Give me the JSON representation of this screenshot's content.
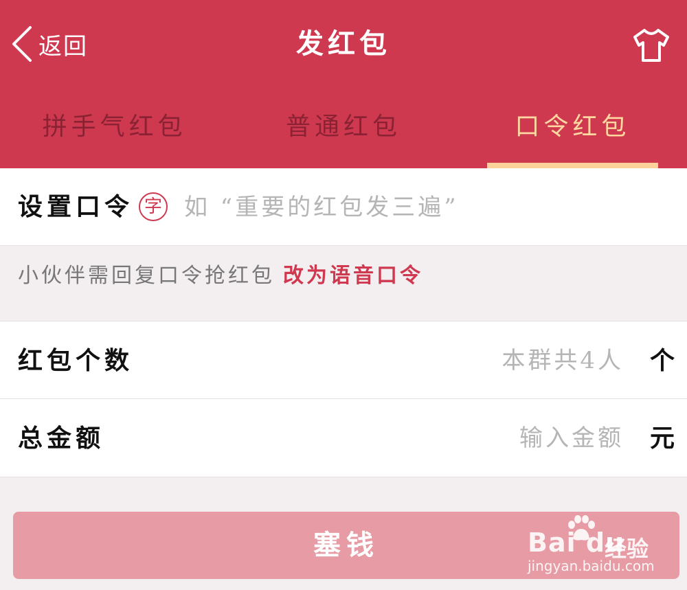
{
  "header": {
    "back_label": "返回",
    "title": "发红包",
    "right_icon": "shirt-icon"
  },
  "tabs": [
    {
      "label": "拼手气红包",
      "active": false
    },
    {
      "label": "普通红包",
      "active": false
    },
    {
      "label": "口令红包",
      "active": true
    }
  ],
  "command": {
    "label": "设置口令",
    "type_icon": "字",
    "placeholder": "如 “重要的红包发三遍”",
    "value": ""
  },
  "hint": {
    "text": "小伙伴需回复口令抢红包",
    "link": "改为语音口令"
  },
  "count": {
    "label": "红包个数",
    "placeholder": "本群共4人",
    "unit": "个"
  },
  "amount": {
    "label": "总金额",
    "placeholder": "输入金额",
    "unit": "元"
  },
  "submit_label": "塞钱",
  "watermark": {
    "logo": "Bai  du",
    "cn": "经验",
    "url": "jingyan.baidu.com"
  },
  "colors": {
    "brand": "#cf3950",
    "tab_active": "#ffd7a0",
    "button": "#e79ba4"
  }
}
